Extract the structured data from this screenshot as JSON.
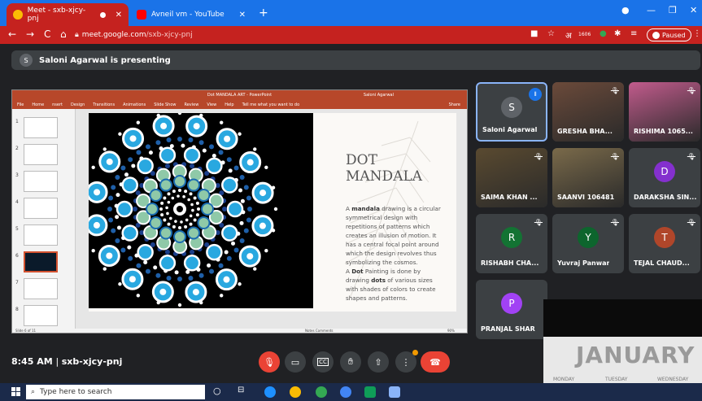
{
  "browser": {
    "tabs": [
      {
        "label": "Meet - sxb-xjcy-pnj",
        "active": true,
        "icon": "meet-icon"
      },
      {
        "label": "Avneil vm - YouTube",
        "active": false,
        "icon": "youtube-icon"
      }
    ],
    "new_tab_symbol": "+",
    "address": {
      "host": "meet.google.com",
      "path": "/sxb-xjcy-pnj"
    },
    "extension_badge": "1606",
    "paused_label": "Paused",
    "colors": {
      "tabstrip": "#1a73e8",
      "active_tab": "#c5221f"
    }
  },
  "meet": {
    "presenting_banner": {
      "initial": "S",
      "text": "Saloni Agarwal is presenting"
    },
    "presentation": {
      "window_title": "Dot MANDALA ART - PowerPoint",
      "user": "Saloni Agarwal",
      "menu": [
        "File",
        "Home",
        "nsert",
        "Design",
        "Transitions",
        "Animations",
        "Slide Show",
        "Review",
        "View",
        "Help",
        "Tell me what you want to do",
        "Share"
      ],
      "thumbnail_numbers": [
        "1",
        "2",
        "3",
        "4",
        "5",
        "6",
        "7",
        "8"
      ],
      "selected_slide": "6",
      "slide_title_line1": "DOT",
      "slide_title_line2": "MANDALA",
      "slide_body_parts": [
        {
          "t": "A ",
          "b": false
        },
        {
          "t": "mandala",
          "b": true
        },
        {
          "t": " drawing is a circular symmetrical design with repetitions of patterns which creates an illusion of motion. It has a central focal point around which the design revolves thus symbolizing the cosmos.",
          "b": false
        },
        {
          "t": "\nA ",
          "b": false
        },
        {
          "t": "Dot",
          "b": true
        },
        {
          "t": " Painting is done by drawing ",
          "b": false
        },
        {
          "t": "dots",
          "b": true
        },
        {
          "t": " of various sizes with shades of colors to create shapes and patterns.",
          "b": false
        }
      ],
      "status_left": "Slide 6 of 11",
      "status_right": "Notes   Comments",
      "zoom": "90%"
    },
    "participants": [
      {
        "name": "Saloni Agarwal",
        "initial": "S",
        "color": "#5f6368",
        "muted": false,
        "speaking": true,
        "photo": false
      },
      {
        "name": "GRESHA BHA...",
        "initial": "",
        "color": "#6b4a3a",
        "muted": true,
        "speaking": false,
        "photo": true
      },
      {
        "name": "RISHIMA 1065...",
        "initial": "",
        "color": "#c15b8c",
        "muted": true,
        "speaking": false,
        "photo": true
      },
      {
        "name": "SAIMA KHAN ...",
        "initial": "",
        "color": "#5a4a30",
        "muted": true,
        "speaking": false,
        "photo": true
      },
      {
        "name": "SAANVI 106481",
        "initial": "",
        "color": "#7a6a4a",
        "muted": true,
        "speaking": false,
        "photo": true
      },
      {
        "name": "DARAKSHA SIN...",
        "initial": "D",
        "color": "#8430ce",
        "muted": true,
        "speaking": false,
        "photo": false
      },
      {
        "name": "RISHABH CHA...",
        "initial": "R",
        "color": "#137333",
        "muted": true,
        "speaking": false,
        "photo": false
      },
      {
        "name": "Yuvraj Panwar",
        "initial": "Y",
        "color": "#0d652d",
        "muted": true,
        "speaking": false,
        "photo": false
      },
      {
        "name": "TEJAL CHAUD...",
        "initial": "T",
        "color": "#b0462a",
        "muted": true,
        "speaking": false,
        "photo": false
      },
      {
        "name": "PRANJAL SHAR",
        "initial": "P",
        "color": "#a142f4",
        "muted": false,
        "speaking": false,
        "photo": false
      }
    ],
    "calendar_month": "JANUARY",
    "calendar_days": [
      "MONDAY",
      "TUESDAY",
      "WEDNESDAY"
    ],
    "time": "8:45 AM",
    "meeting_code": "sxb-xjcy-pnj",
    "controls": [
      {
        "name": "mic-off",
        "icon": "mic-off-icon",
        "red": true
      },
      {
        "name": "camera",
        "icon": "camera-icon",
        "red": false
      },
      {
        "name": "captions",
        "icon": "captions-icon",
        "red": false
      },
      {
        "name": "raise-hand",
        "icon": "hand-icon",
        "red": false
      },
      {
        "name": "present",
        "icon": "present-icon",
        "red": false
      },
      {
        "name": "more",
        "icon": "more-vert-icon",
        "red": false
      },
      {
        "name": "leave",
        "icon": "phone-end-icon",
        "red": true
      }
    ]
  },
  "taskbar": {
    "search_placeholder": "Type here to search"
  }
}
